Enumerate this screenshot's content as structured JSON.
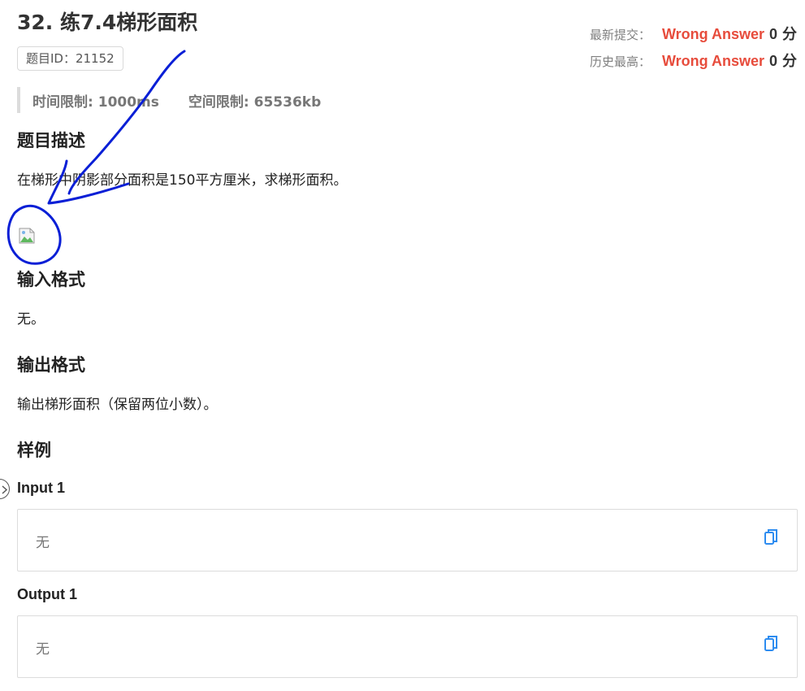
{
  "problem": {
    "title": "32. 练7.4梯形面积",
    "id_badge": "题目ID：21152",
    "limits": {
      "time_label": "时间限制:",
      "time_value": "1000ms",
      "memory_label": "空间限制:",
      "memory_value": "65536kb"
    }
  },
  "status": {
    "latest": {
      "label": "最新提交：",
      "verdict": "Wrong Answer",
      "score": "0",
      "unit": "分"
    },
    "best": {
      "label": "历史最高：",
      "verdict": "Wrong Answer",
      "score": "0",
      "unit": "分"
    }
  },
  "sections": {
    "description_heading": "题目描述",
    "description_text": "在梯形中阴影部分面积是150平方厘米，求梯形面积。",
    "input_heading": "输入格式",
    "input_text": "无。",
    "output_heading": "输出格式",
    "output_text": "输出梯形面积（保留两位小数）。",
    "samples_heading": "样例"
  },
  "samples": [
    {
      "input_label": "Input 1",
      "input_value": "无",
      "output_label": "Output 1",
      "output_value": "无"
    }
  ],
  "icons": {
    "broken_image": "broken-image-icon",
    "copy": "copy-icon",
    "side_toggle": "chevron-icon"
  },
  "colors": {
    "verdict_red": "#e74c3c",
    "annotation_blue": "#0a1fd6",
    "copy_blue": "#2d8cf0"
  }
}
